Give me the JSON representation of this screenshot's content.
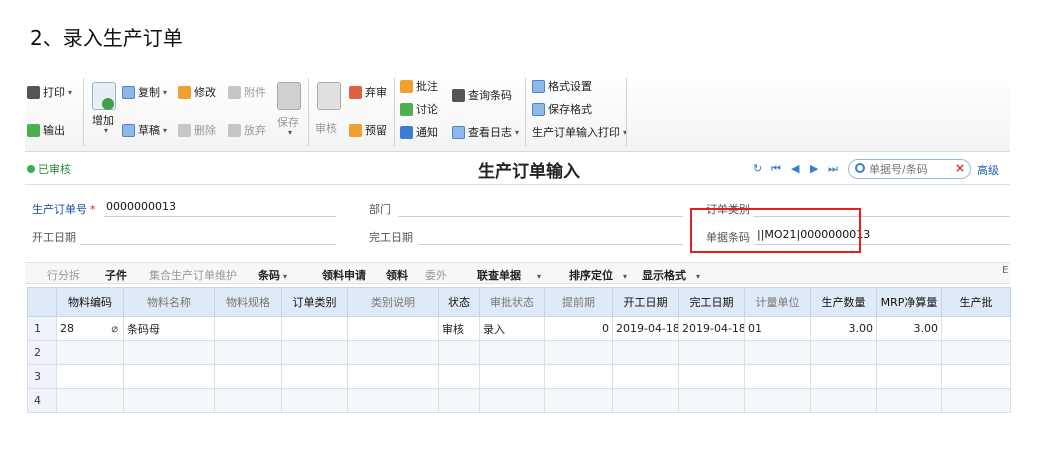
{
  "doc_heading": "2、录入生产订单",
  "toolbar": {
    "print": "打印",
    "export": "输出",
    "add": "增加",
    "copy": "复制",
    "modify": "修改",
    "attachment": "附件",
    "draft": "草稿",
    "delete": "删除",
    "discard": "放弃",
    "save": "保存",
    "audit": "审核",
    "abandon_audit": "弃审",
    "reserve": "预留",
    "annotate": "批注",
    "discuss": "讨论",
    "notify": "通知",
    "query_barcode": "查询条码",
    "view_log": "查看日志",
    "format_settings": "格式设置",
    "save_format": "保存格式",
    "print_input": "生产订单输入打印"
  },
  "titlebar": {
    "status": "已审核",
    "title": "生产订单输入",
    "search_placeholder": "单据号/条码",
    "search_clear": "×",
    "advanced": "高级"
  },
  "header_form": {
    "order_no_label": "生产订单号",
    "order_no_value": "0000000013",
    "department_label": "部门",
    "order_type_label": "订单类别",
    "start_date_label": "开工日期",
    "finish_date_label": "完工日期",
    "barcode_label": "单据条码",
    "barcode_value": "||MO21|0000000013"
  },
  "grid_toolbar": {
    "split_row": "行分拆",
    "child": "子件",
    "collective": "集合生产订单维护",
    "barcode": "条码",
    "material_request": "领料申请",
    "material_pick": "领料",
    "outsource": "委外",
    "linked_query": "联查单据",
    "sort_locate": "排序定位",
    "display_format": "显示格式",
    "edge_glyph": "E"
  },
  "grid": {
    "columns": [
      "物料编码",
      "物料名称",
      "物料规格",
      "订单类别",
      "类别说明",
      "状态",
      "审批状态",
      "提前期",
      "开工日期",
      "完工日期",
      "计量单位",
      "生产数量",
      "MRP净算量",
      "生产批"
    ],
    "rows": [
      {
        "rn": "1",
        "material_code": "28",
        "material_name": "条码母",
        "material_spec": "",
        "order_type": "",
        "type_desc": "",
        "status": "审核",
        "approval": "录入",
        "lead_time": "0",
        "start": "2019-04-18",
        "finish": "2019-04-18",
        "unit": "01",
        "qty": "3.00",
        "mrp_qty": "3.00",
        "batch": ""
      },
      {
        "rn": "2"
      },
      {
        "rn": "3"
      },
      {
        "rn": "4"
      }
    ]
  }
}
